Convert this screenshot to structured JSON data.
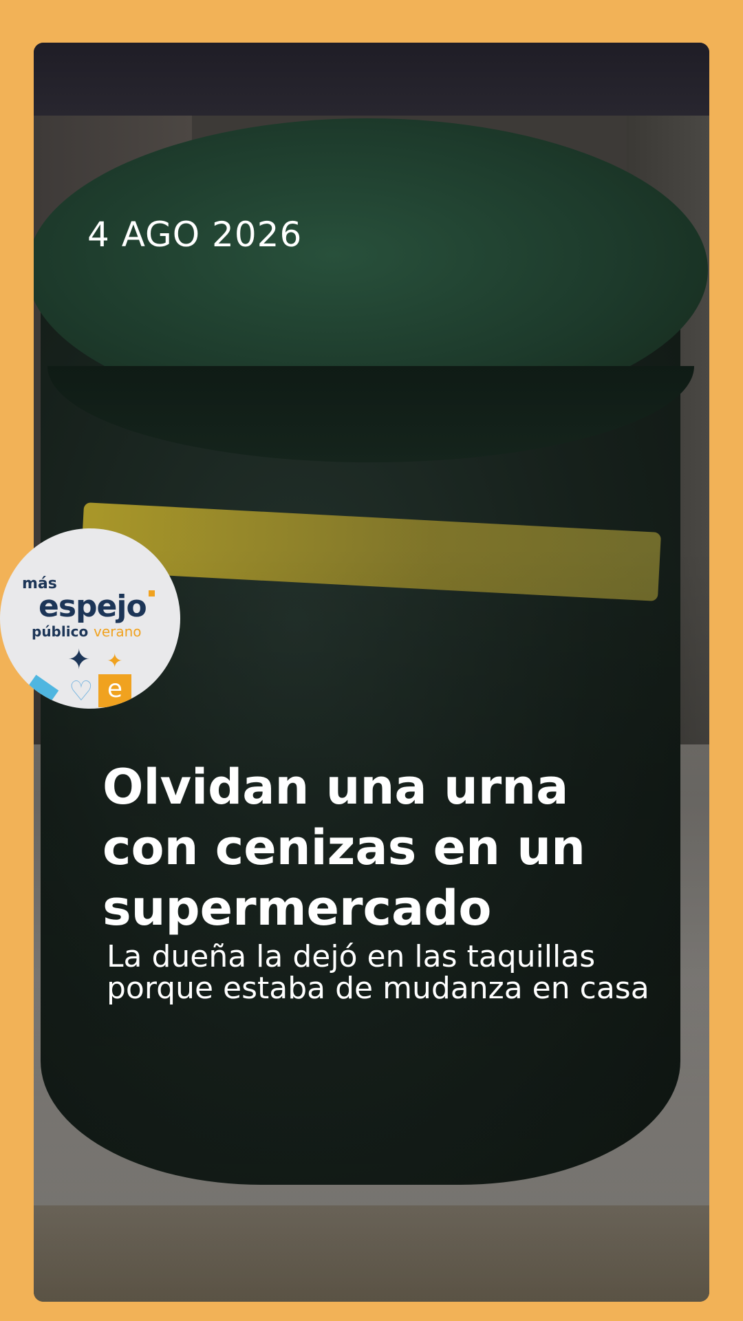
{
  "story": {
    "date": "4 AGO 2026",
    "headline": "Olvidan una urna con cenizas en un supermercado",
    "subheadline": "La dueña la dejó en las taquillas porque estaba de mudanza en casa"
  },
  "badge": {
    "mas": "más",
    "espejo": "espejo",
    "publico": "público",
    "verano": "verano",
    "e_tile": "e"
  },
  "colors": {
    "background": "#f2b257",
    "brand_navy": "#1c3557",
    "brand_orange": "#f0a21f"
  },
  "icons": [
    "sparkle-icon",
    "heart-icon"
  ]
}
